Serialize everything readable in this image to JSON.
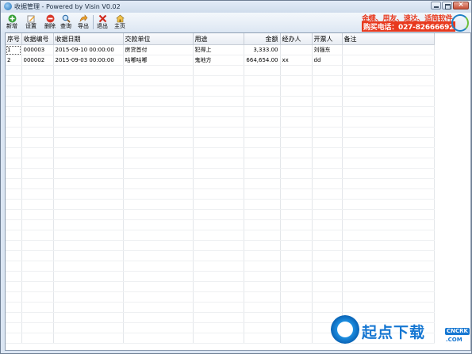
{
  "window": {
    "title": "收据管理 - Powered by Visin V0.02"
  },
  "toolbar": {
    "buttons": [
      {
        "label": "新增",
        "icon": "add-icon"
      },
      {
        "label": "设置",
        "icon": "edit-icon"
      },
      {
        "label": "删除",
        "icon": "delete-icon"
      },
      {
        "label": "查询",
        "icon": "search-icon"
      },
      {
        "label": "导出",
        "icon": "export-icon"
      },
      {
        "label": "退出",
        "icon": "exit-icon"
      },
      {
        "label": "主页",
        "icon": "home-icon"
      }
    ]
  },
  "banner": {
    "line1": "金蝶、用友、速达、适简软件",
    "line2": "购买电话：027-82666692",
    "color": "#e8391e"
  },
  "table": {
    "columns": [
      "序号",
      "收据编号",
      "收据日期",
      "交款单位",
      "用途",
      "金额",
      "经办人",
      "开票人",
      "备注"
    ],
    "rows": [
      [
        "1",
        "000003",
        "2015-09-10 00:00:00",
        "房贷首付",
        "犯得上",
        "3,333.00",
        "",
        "刘强东",
        ""
      ],
      [
        "2",
        "000002",
        "2015-09-03 00:00:00",
        "咕嘟咕嘟",
        "鬼地方",
        "664,654.00",
        "xx",
        "dd",
        ""
      ]
    ]
  },
  "watermark": {
    "text": "起点下载",
    "badge": "CNCRK",
    "domain": ".COM",
    "color": "#1677d2"
  }
}
